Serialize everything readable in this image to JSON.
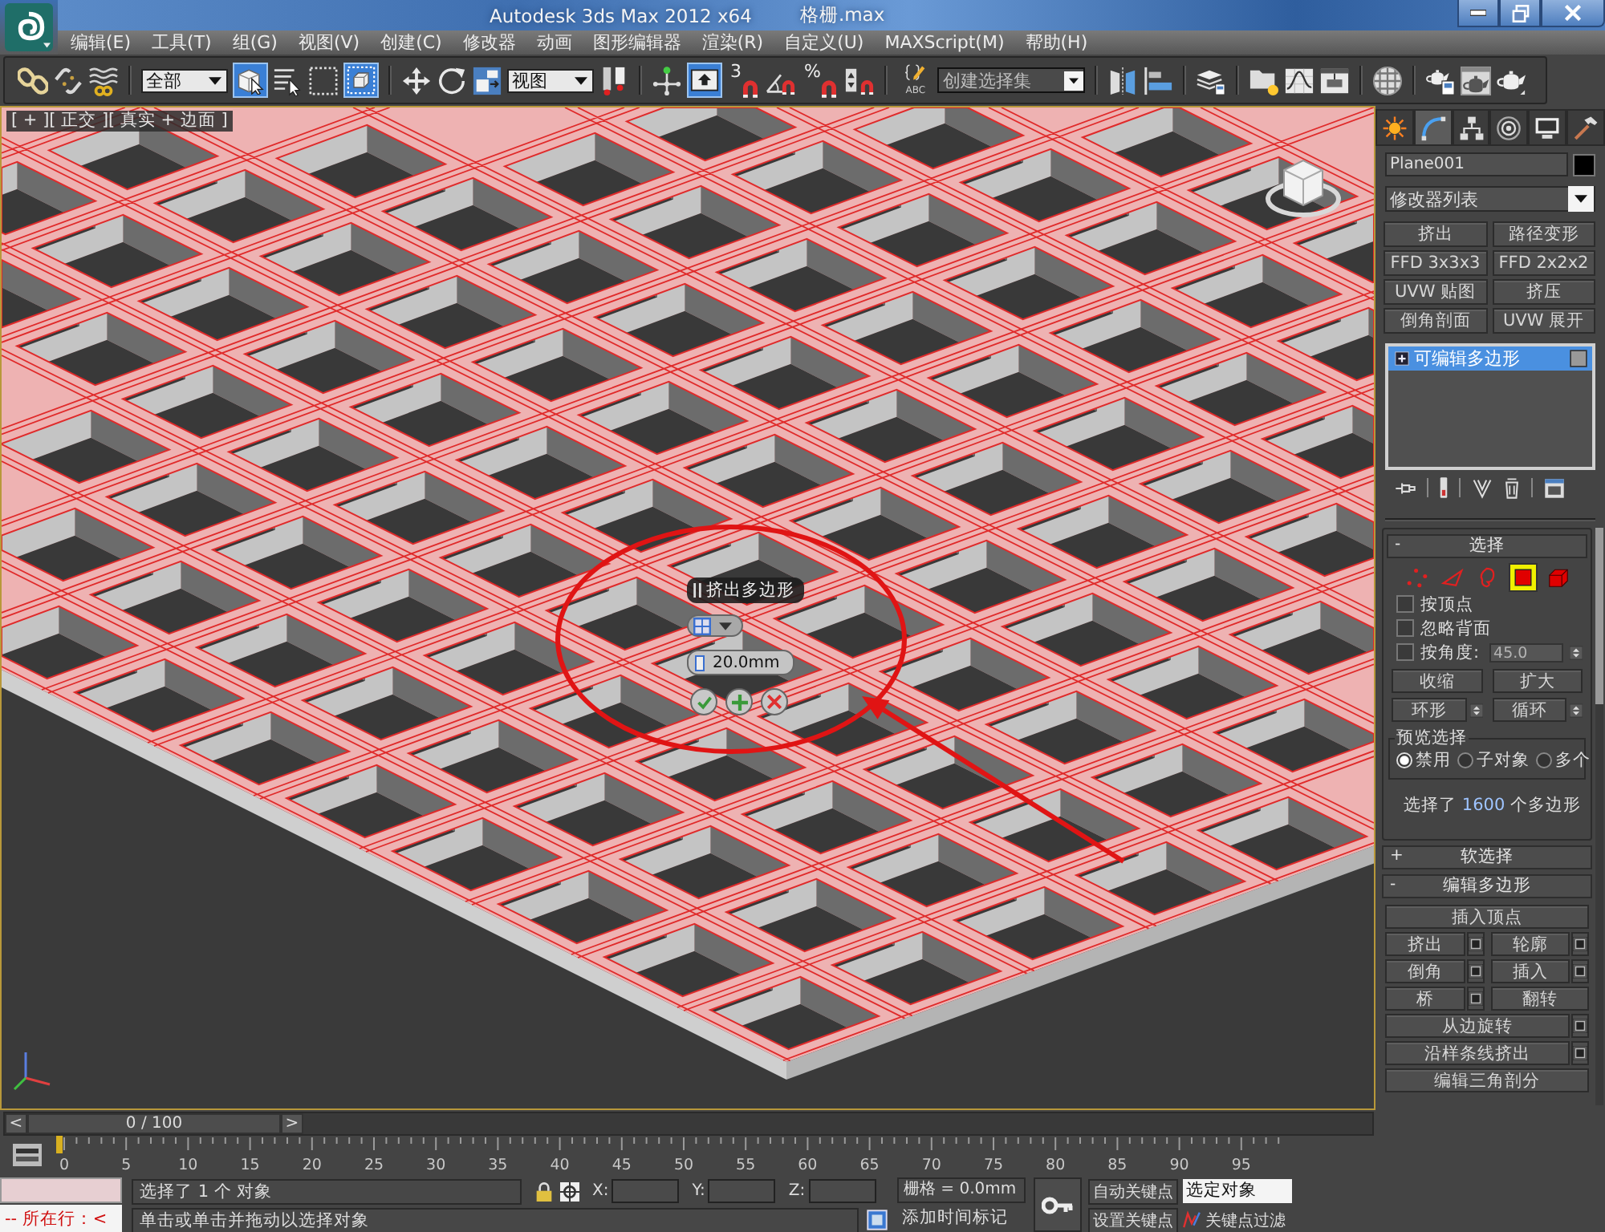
{
  "title_bar": {
    "title": "Autodesk 3ds Max  2012 x64",
    "file": "格栅.max"
  },
  "menu": [
    "编辑(E)",
    "工具(T)",
    "组(G)",
    "视图(V)",
    "创建(C)",
    "修改器",
    "动画",
    "图形编辑器",
    "渲染(R)",
    "自定义(U)",
    "MAXScript(M)",
    "帮助(H)"
  ],
  "main_toolbar": [
    [
      {
        "kind": "link",
        "active": false
      },
      {
        "kind": "unlink",
        "active": false
      },
      {
        "kind": "bind",
        "active": false
      }
    ],
    [
      {
        "kind": "dropdown",
        "value": "全部"
      },
      {
        "kind": "select",
        "active": true
      },
      {
        "kind": "select_by_name",
        "active": false
      },
      {
        "kind": "region",
        "active": false
      },
      {
        "kind": "crossing",
        "active": true
      }
    ],
    [
      {
        "kind": "move",
        "active": false
      },
      {
        "kind": "rotate",
        "active": false
      },
      {
        "kind": "scale",
        "active": false
      },
      {
        "kind": "dropdown",
        "value": "视图"
      },
      {
        "kind": "pivot",
        "active": false
      }
    ],
    [
      {
        "kind": "manipulate",
        "active": false
      },
      {
        "kind": "shortcut",
        "active": true
      },
      {
        "kind": "snap",
        "label": "3",
        "active": false
      },
      {
        "kind": "angle_snap",
        "active": false
      },
      {
        "kind": "percent_snap",
        "label": "%",
        "active": false
      },
      {
        "kind": "spinner_snap",
        "active": false
      }
    ],
    [
      {
        "kind": "named_sets",
        "label": "ABC",
        "active": false
      },
      {
        "kind": "set_field",
        "placeholder": "创建选择集"
      }
    ],
    [
      {
        "kind": "mirror",
        "active": false
      },
      {
        "kind": "align",
        "active": false
      }
    ],
    [
      {
        "kind": "layers",
        "active": false
      }
    ],
    [
      {
        "kind": "explorer",
        "active": false
      },
      {
        "kind": "curve_editor",
        "active": false
      },
      {
        "kind": "schematic",
        "active": false
      }
    ],
    [
      {
        "kind": "material",
        "active": false
      }
    ],
    [
      {
        "kind": "render_setup",
        "active": false
      },
      {
        "kind": "render_frame",
        "active": false
      },
      {
        "kind": "render",
        "active": false
      }
    ]
  ],
  "viewport": {
    "label": "[ + ][ 正交 ][ 真实 + 边面 ]",
    "caddy": {
      "title": "挤出多边形",
      "value": "20.0mm"
    }
  },
  "command_panel": {
    "tabs": [
      {
        "kind": "create",
        "selected": false
      },
      {
        "kind": "modify",
        "selected": true
      },
      {
        "kind": "hierarchy",
        "selected": false
      },
      {
        "kind": "motion",
        "selected": false
      },
      {
        "kind": "display",
        "selected": false
      },
      {
        "kind": "utilities",
        "selected": false
      }
    ],
    "object_name": "Plane001",
    "modifier_list": "修改器列表",
    "modifier_buttons": [
      "挤出",
      "路径变形",
      "FFD 3x3x3",
      "FFD 2x2x2",
      "UVW 贴图",
      "挤压",
      "倒角剖面",
      "UVW 展开"
    ],
    "stack": [
      {
        "label": "可编辑多边形",
        "selected": true
      }
    ],
    "selection_rollout": {
      "toggle": "-",
      "title": "选择",
      "levels": [
        {
          "kind": "vertex",
          "selected": false
        },
        {
          "kind": "edge",
          "selected": false
        },
        {
          "kind": "border",
          "selected": false
        },
        {
          "kind": "polygon",
          "selected": true
        },
        {
          "kind": "element",
          "selected": false
        }
      ],
      "options": [
        {
          "label": "按顶点",
          "checked": false
        },
        {
          "label": "忽略背面",
          "checked": false
        },
        {
          "label": "按角度:",
          "checked": false,
          "value": "45.0",
          "disabled": true
        }
      ],
      "buttons": [
        {
          "label": "收缩",
          "spinner": false
        },
        {
          "label": "扩大",
          "spinner": false
        },
        {
          "label": "环形",
          "spinner": true
        },
        {
          "label": "循环",
          "spinner": true
        }
      ],
      "preview": {
        "title": "预览选择",
        "options": [
          {
            "label": "禁用",
            "selected": true
          },
          {
            "label": "子对象",
            "selected": false
          },
          {
            "label": "多个",
            "selected": false
          }
        ]
      },
      "info": {
        "before": "选择了 ",
        "count": "1600",
        "after": " 个多边形"
      }
    },
    "soft_selection_rollout": {
      "toggle": "+",
      "title": "软选择"
    },
    "edit_polygons_rollout": {
      "toggle": "-",
      "title": "编辑多边形",
      "rows": [
        [
          {
            "label": "插入顶点",
            "settings": false
          }
        ],
        [
          {
            "label": "挤出",
            "settings": true
          },
          {
            "label": "轮廓",
            "settings": true
          }
        ],
        [
          {
            "label": "倒角",
            "settings": true
          },
          {
            "label": "插入",
            "settings": true
          }
        ],
        [
          {
            "label": "桥",
            "settings": true
          },
          {
            "label": "翻转",
            "settings": false
          }
        ],
        [
          {
            "label": "从边旋转",
            "settings": true
          }
        ],
        [
          {
            "label": "沿样条线挤出",
            "settings": true
          }
        ],
        [
          {
            "label": "编辑三角剖分",
            "settings": false
          }
        ]
      ]
    }
  },
  "time_slider": {
    "prev": "<",
    "position": "0 / 100",
    "next": ">",
    "level": 0,
    "frames": [
      "0",
      "5",
      "10",
      "15",
      "20",
      "25",
      "30",
      "35",
      "40",
      "45",
      "50",
      "55",
      "60",
      "65",
      "70",
      "75",
      "80",
      "85",
      "90",
      "95"
    ]
  },
  "status_bar": {
    "listener_output": "--  所在行：<",
    "prompt": "选择了 1 个 对象",
    "hint": "单击或单击并拖动以选择对象",
    "coords": [
      "X:",
      "Y:",
      "Z:"
    ],
    "grid": "栅格 = 0.0mm",
    "time_tag": "添加时间标记",
    "auto_key": "自动关键点",
    "key_mode": "选定对象",
    "set_key": "设置关键点",
    "key_filters": "关键点过滤"
  }
}
